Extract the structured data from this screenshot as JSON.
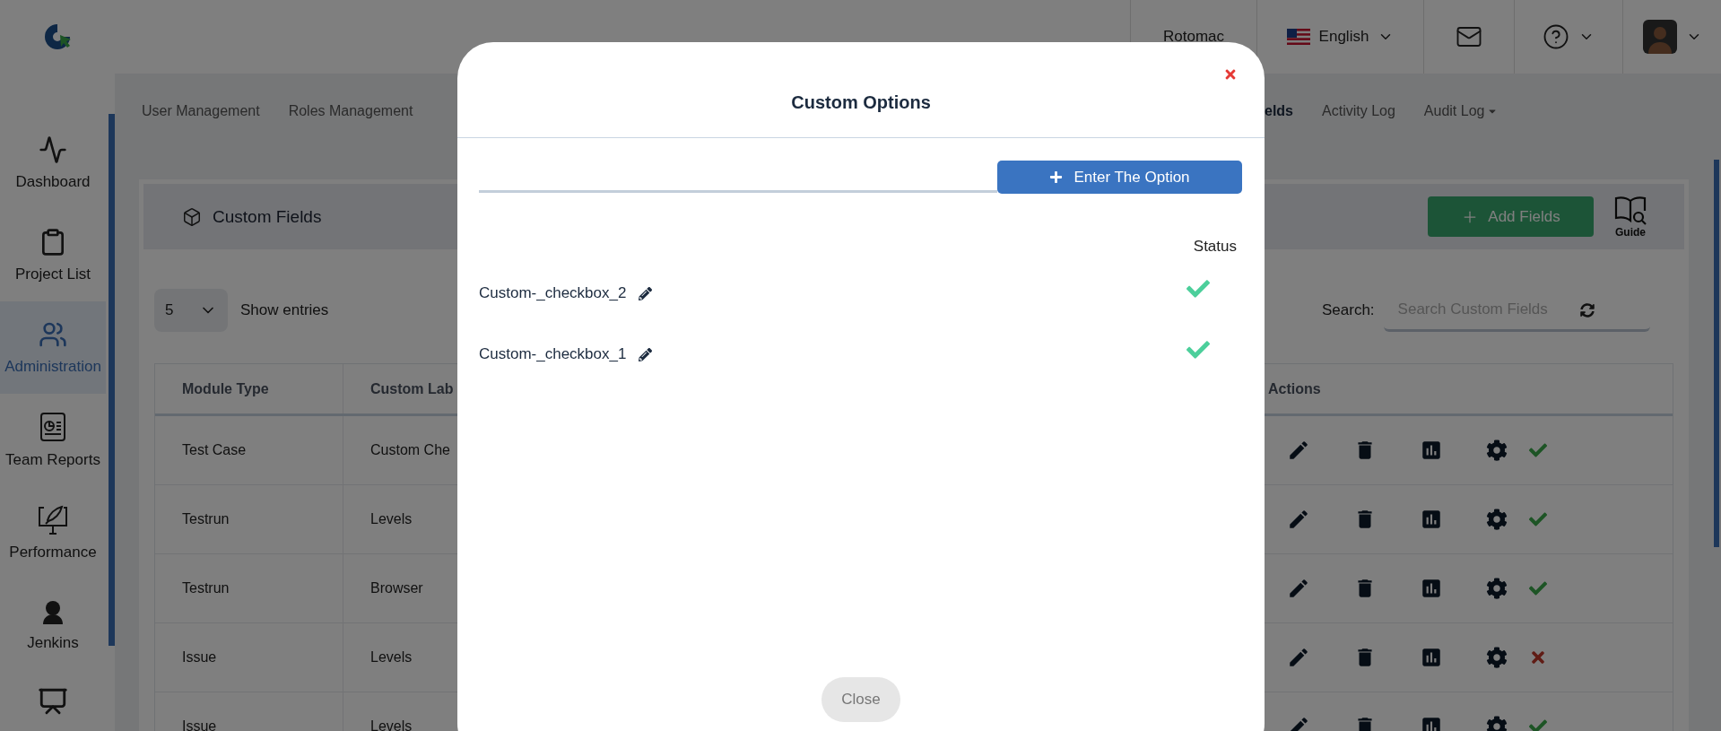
{
  "topbar": {
    "company": "Rotomac",
    "language": "English"
  },
  "sidebar": {
    "items": [
      {
        "label": "Dashboard",
        "selected": false
      },
      {
        "label": "Project List",
        "selected": false
      },
      {
        "label": "Administration",
        "selected": true
      },
      {
        "label": "Team Reports",
        "selected": false
      },
      {
        "label": "Performance",
        "selected": false
      },
      {
        "label": "Jenkins",
        "selected": false
      },
      {
        "selected": false
      }
    ]
  },
  "tabs": [
    {
      "label": "User Management",
      "selected": false,
      "has_menu": false
    },
    {
      "label": "Roles Management",
      "selected": false,
      "has_menu": false
    },
    {
      "label": "elds",
      "selected": true,
      "has_menu": false
    },
    {
      "label": "Activity Log",
      "selected": false,
      "has_menu": false
    },
    {
      "label": "Audit Log",
      "selected": false,
      "has_menu": true
    }
  ],
  "card": {
    "title": "Custom Fields",
    "add_button": "Add Fields",
    "guide": "Guide",
    "page_size": "5",
    "show_entries": "Show entries",
    "search_label": "Search:",
    "search_placeholder": "Search Custom Fields"
  },
  "table": {
    "columns": [
      "Module Type",
      "Custom Lab",
      "Actions"
    ],
    "rows": [
      {
        "module_type": "Test Case",
        "custom_label": "Custom Che",
        "active": true
      },
      {
        "module_type": "Testrun",
        "custom_label": "Levels",
        "active": true
      },
      {
        "module_type": "Testrun",
        "custom_label": "Browser",
        "active": true
      },
      {
        "module_type": "Issue",
        "custom_label": "Levels",
        "active": false
      },
      {
        "module_type": "Issue",
        "custom_label": "Levels",
        "active": true
      }
    ]
  },
  "modal": {
    "title": "Custom Options",
    "add_button": "Enter The Option",
    "status_header": "Status",
    "options": [
      {
        "name": "Custom-_checkbox_2",
        "active": true
      },
      {
        "name": "Custom-_checkbox_1",
        "active": true
      }
    ],
    "close_button": "Close"
  }
}
